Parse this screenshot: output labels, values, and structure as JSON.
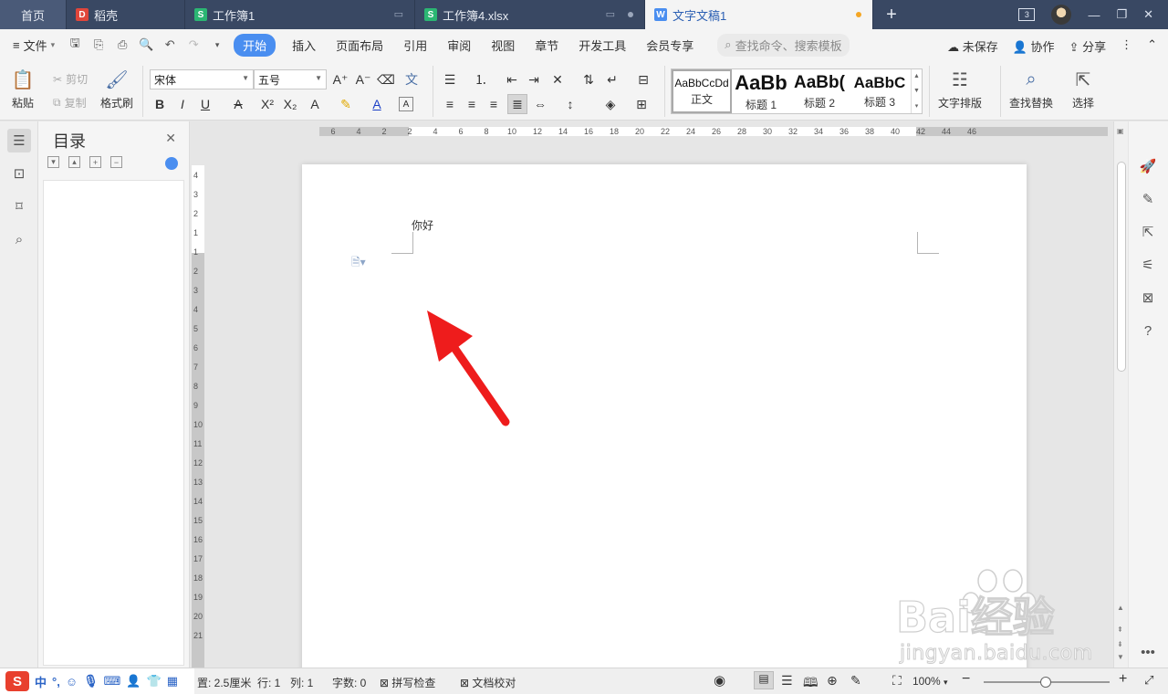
{
  "tabs": {
    "home": "首页",
    "t1": "稻壳",
    "t2": "工作簿1",
    "t3": "工作簿4.xlsx",
    "active": "文字文稿1",
    "add": "+",
    "window_count": "3"
  },
  "menu": {
    "file": "文件",
    "items": [
      "开始",
      "插入",
      "页面布局",
      "引用",
      "审阅",
      "视图",
      "章节",
      "开发工具",
      "会员专享"
    ],
    "search": "查找命令、搜索模板",
    "unsaved": "未保存",
    "collab": "协作",
    "share": "分享"
  },
  "ribbon": {
    "paste": "粘贴",
    "cut": "剪切",
    "copy": "复制",
    "format_painter": "格式刷",
    "font_name": "宋体",
    "font_size": "五号",
    "styles": [
      {
        "sample": "AaBbCcDd",
        "name": "正文"
      },
      {
        "sample": "AaBb",
        "name": "标题 1"
      },
      {
        "sample": "AaBb(",
        "name": "标题 2"
      },
      {
        "sample": "AaBbC",
        "name": "标题 3"
      }
    ],
    "text_layout": "文字排版",
    "find_replace": "查找替换",
    "select": "选择"
  },
  "toc": {
    "title": "目录"
  },
  "ruler": {
    "h_numbers": [
      "6",
      "4",
      "2",
      "2",
      "4",
      "6",
      "8",
      "10",
      "12",
      "14",
      "16",
      "18",
      "20",
      "22",
      "24",
      "26",
      "28",
      "30",
      "32",
      "34",
      "36",
      "38",
      "40",
      "42",
      "44",
      "46"
    ],
    "v_numbers": [
      "4",
      "3",
      "2",
      "1",
      "1",
      "2",
      "3",
      "4",
      "5",
      "6",
      "7",
      "8",
      "9",
      "10",
      "11",
      "12",
      "13",
      "14",
      "15",
      "16",
      "17",
      "18",
      "19",
      "20",
      "21"
    ]
  },
  "document": {
    "text": "你好"
  },
  "status": {
    "margin": "置: 2.5厘米",
    "line": "行: 1",
    "col": "列: 1",
    "words": "字数: 0",
    "spell": "拼写检查",
    "proof": "文档校对",
    "zoom": "100%"
  },
  "ime": {
    "logo": "S",
    "mode": "中"
  },
  "watermark": {
    "brand": "Bai经验",
    "url": "jingyan.baidu.com"
  },
  "colors": {
    "tabbar": "#394863",
    "accent": "#4a8ef0",
    "arrow": "#ee1c1c"
  }
}
